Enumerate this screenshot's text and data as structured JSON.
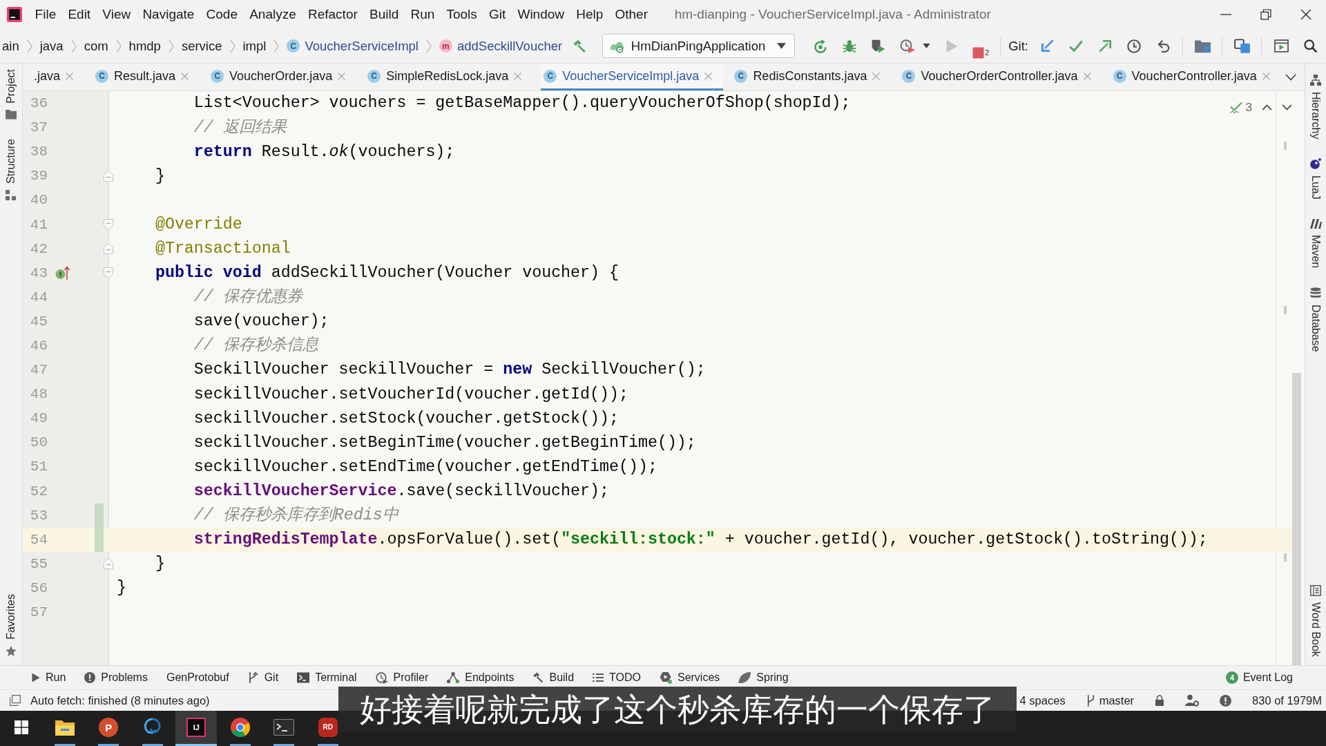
{
  "window": {
    "title": "hm-dianping - VoucherServiceImpl.java - Administrator"
  },
  "menu": [
    "File",
    "Edit",
    "View",
    "Navigate",
    "Code",
    "Analyze",
    "Refactor",
    "Build",
    "Run",
    "Tools",
    "Git",
    "Window",
    "Help",
    "Other"
  ],
  "breadcrumbs": [
    {
      "label": "ain",
      "kind": "folder"
    },
    {
      "label": "java",
      "kind": "folder"
    },
    {
      "label": "com",
      "kind": "folder"
    },
    {
      "label": "hmdp",
      "kind": "folder"
    },
    {
      "label": "service",
      "kind": "folder"
    },
    {
      "label": "impl",
      "kind": "folder"
    },
    {
      "label": "VoucherServiceImpl",
      "kind": "class",
      "mark": "C"
    },
    {
      "label": "addSeckillVoucher",
      "kind": "method",
      "mark": "m"
    }
  ],
  "toolbar": {
    "run_configuration": "HmDianPingApplication",
    "run_disabled": true,
    "stop_count": "2",
    "vcs_label": "Git:"
  },
  "tabs": [
    {
      "label": ".java",
      "selected": false
    },
    {
      "label": "Result.java",
      "mark": "C",
      "selected": false
    },
    {
      "label": "VoucherOrder.java",
      "mark": "C",
      "selected": false
    },
    {
      "label": "SimpleRedisLock.java",
      "mark": "C",
      "selected": false
    },
    {
      "label": "VoucherServiceImpl.java",
      "mark": "C",
      "selected": true
    },
    {
      "label": "RedisConstants.java",
      "mark": "C",
      "selected": false
    },
    {
      "label": "VoucherOrderController.java",
      "mark": "C",
      "selected": false
    },
    {
      "label": "VoucherController.java",
      "mark": "C",
      "selected": false
    }
  ],
  "left_tool_strip": {
    "top": [
      {
        "label": "Project",
        "kind": "project"
      },
      {
        "label": "Structure",
        "kind": "structure"
      }
    ],
    "bottom": [
      {
        "label": "Favorites",
        "kind": "favorites"
      }
    ]
  },
  "right_tool_strip": {
    "top": [
      {
        "label": "Hierarchy",
        "kind": "hierarchy"
      },
      {
        "label": "LuaJ",
        "kind": "luaj"
      },
      {
        "label": "Maven",
        "kind": "maven"
      },
      {
        "label": "Database",
        "kind": "database"
      }
    ],
    "bottom": [
      {
        "label": "Word Book",
        "kind": "wordbook"
      }
    ]
  },
  "editor": {
    "problems": "3",
    "lines": [
      {
        "number": "36",
        "current": false,
        "changed": false,
        "tokens": [
          {
            "kind": "plain",
            "text": "        List<Voucher> vouchers = getBaseMapper().queryVoucherOfShop(shopId);"
          }
        ]
      },
      {
        "number": "37",
        "current": false,
        "changed": false,
        "tokens": [
          {
            "kind": "comment",
            "text": "        // 返回结果"
          }
        ]
      },
      {
        "number": "38",
        "current": false,
        "changed": false,
        "tokens": [
          {
            "kind": "keyword",
            "text": "        return"
          },
          {
            "kind": "plain",
            "text": " Result."
          },
          {
            "kind": "static",
            "text": "ok"
          },
          {
            "kind": "plain",
            "text": "(vouchers);"
          }
        ]
      },
      {
        "number": "39",
        "current": false,
        "changed": false,
        "gutter_marks": [
          {
            "kind": "fold_end"
          }
        ],
        "tokens": [
          {
            "kind": "plain",
            "text": "    }"
          }
        ]
      },
      {
        "number": "40",
        "current": false,
        "changed": false
      },
      {
        "number": "41",
        "current": false,
        "changed": false,
        "gutter_marks": [
          {
            "kind": "fold_start"
          }
        ],
        "tokens": [
          {
            "kind": "annotation",
            "text": "    @Override"
          }
        ]
      },
      {
        "number": "42",
        "current": false,
        "changed": false,
        "gutter_marks": [
          {
            "kind": "fold_end"
          }
        ],
        "tokens": [
          {
            "kind": "annotation",
            "text": "    @Transactional"
          }
        ]
      },
      {
        "number": "43",
        "current": false,
        "changed": false,
        "gutter_marks": [
          {
            "kind": "implements"
          },
          {
            "kind": "fold_start"
          }
        ],
        "tokens": [
          {
            "kind": "keyword",
            "text": "    public void"
          },
          {
            "kind": "plain",
            "text": " addSeckillVoucher(Voucher voucher) {"
          }
        ]
      },
      {
        "number": "44",
        "current": false,
        "changed": false,
        "tokens": [
          {
            "kind": "comment",
            "text": "        // 保存优惠券"
          }
        ]
      },
      {
        "number": "45",
        "current": false,
        "changed": false,
        "tokens": [
          {
            "kind": "plain",
            "text": "        save(voucher);"
          }
        ]
      },
      {
        "number": "46",
        "current": false,
        "changed": false,
        "tokens": [
          {
            "kind": "comment",
            "text": "        // 保存秒杀信息"
          }
        ]
      },
      {
        "number": "47",
        "current": false,
        "changed": false,
        "tokens": [
          {
            "kind": "plain",
            "text": "        SeckillVoucher seckillVoucher = "
          },
          {
            "kind": "keyword",
            "text": "new"
          },
          {
            "kind": "plain",
            "text": " SeckillVoucher();"
          }
        ]
      },
      {
        "number": "48",
        "current": false,
        "changed": false,
        "tokens": [
          {
            "kind": "plain",
            "text": "        seckillVoucher.setVoucherId(voucher.getId());"
          }
        ]
      },
      {
        "number": "49",
        "current": false,
        "changed": false,
        "tokens": [
          {
            "kind": "plain",
            "text": "        seckillVoucher.setStock(voucher.getStock());"
          }
        ]
      },
      {
        "number": "50",
        "current": false,
        "changed": false,
        "tokens": [
          {
            "kind": "plain",
            "text": "        seckillVoucher.setBeginTime(voucher.getBeginTime());"
          }
        ]
      },
      {
        "number": "51",
        "current": false,
        "changed": false,
        "tokens": [
          {
            "kind": "plain",
            "text": "        seckillVoucher.setEndTime(voucher.getEndTime());"
          }
        ]
      },
      {
        "number": "52",
        "current": false,
        "changed": false,
        "tokens": [
          {
            "kind": "field",
            "text": "        seckillVoucherService"
          },
          {
            "kind": "plain",
            "text": ".save(seckillVoucher);"
          }
        ]
      },
      {
        "number": "53",
        "current": false,
        "changed": true,
        "tokens": [
          {
            "kind": "comment",
            "text": "        // 保存秒杀库存到Redis中"
          }
        ]
      },
      {
        "number": "54",
        "current": true,
        "changed": true,
        "tokens": [
          {
            "kind": "field",
            "text": "        stringRedisTemplate"
          },
          {
            "kind": "plain",
            "text": ".opsForValue().set("
          },
          {
            "kind": "string",
            "text": "\"seckill:stock:\""
          },
          {
            "kind": "plain",
            "text": " + voucher.getId(), voucher.getStock().toString());"
          }
        ]
      },
      {
        "number": "55",
        "current": false,
        "changed": false,
        "gutter_marks": [
          {
            "kind": "fold_end"
          }
        ],
        "tokens": [
          {
            "kind": "plain",
            "text": "    }"
          }
        ]
      },
      {
        "number": "56",
        "current": false,
        "changed": false,
        "tokens": [
          {
            "kind": "plain",
            "text": "}"
          }
        ]
      },
      {
        "number": "57",
        "current": false,
        "changed": false
      }
    ]
  },
  "tool_windows": [
    {
      "label": "Run",
      "kind": "run"
    },
    {
      "label": "Problems",
      "kind": "problems"
    },
    {
      "label": "GenProtobuf",
      "kind": "protobuf"
    },
    {
      "label": "Git",
      "kind": "git"
    },
    {
      "label": "Terminal",
      "kind": "terminal"
    },
    {
      "label": "Profiler",
      "kind": "profiler"
    },
    {
      "label": "Endpoints",
      "kind": "endpoints"
    },
    {
      "label": "Build",
      "kind": "build"
    },
    {
      "label": "TODO",
      "kind": "todo"
    },
    {
      "label": "Services",
      "kind": "services"
    },
    {
      "label": "Spring",
      "kind": "spring"
    }
  ],
  "event_log": {
    "count": "4",
    "label": "Event Log"
  },
  "status_bar": {
    "message": "Auto fetch: finished (8 minutes ago)",
    "indent": "4 spaces",
    "branch": "master",
    "memory": "830 of 1979M"
  },
  "taskbar": [
    {
      "kind": "start"
    },
    {
      "kind": "explorer",
      "running": true,
      "selected": false
    },
    {
      "kind": "slides",
      "glyph": "P",
      "running": true,
      "selected": false
    },
    {
      "kind": "db_client",
      "running": true,
      "selected": false
    },
    {
      "kind": "ide",
      "glyph": "IJ",
      "running": true,
      "selected": true
    },
    {
      "kind": "browser",
      "running": true,
      "selected": false
    },
    {
      "kind": "terminal",
      "running": true,
      "selected": false
    },
    {
      "kind": "redis_client",
      "glyph": "RD",
      "running": true,
      "selected": false
    }
  ],
  "caption": "好接着呢就完成了这个秒杀库存的一个保存了"
}
